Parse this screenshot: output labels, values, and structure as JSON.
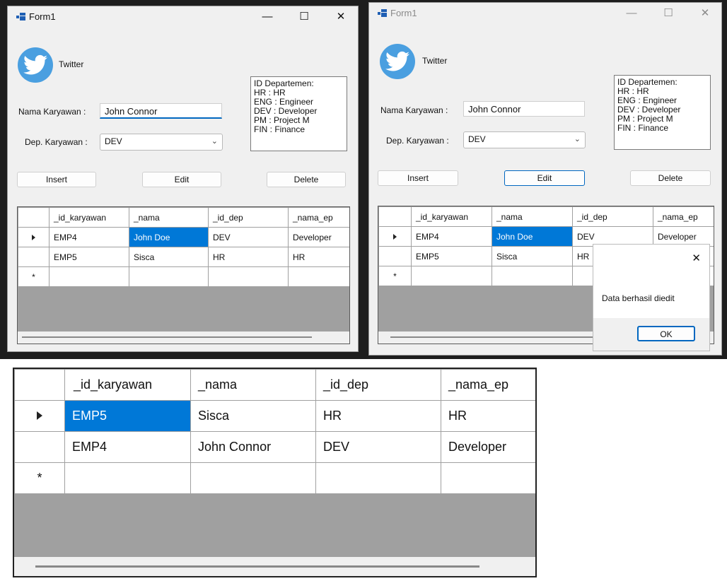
{
  "form": {
    "title": "Form1",
    "logo_label": "Twitter",
    "nama_label": "Nama Karyawan :",
    "nama_value": "John Connor",
    "dep_label": "Dep. Karyawan :",
    "dep_value": "DEV",
    "info_lines": [
      "ID Departemen:",
      "HR : HR",
      "ENG : Engineer",
      "DEV : Developer",
      "PM : Project M",
      "FIN : Finance"
    ],
    "buttons": {
      "insert": "Insert",
      "edit": "Edit",
      "delete": "Delete"
    },
    "window_controls": {
      "minimize": "—",
      "maximize": "☐",
      "close": "✕"
    }
  },
  "grid": {
    "columns": [
      "_id_karyawan",
      "_nama",
      "_id_dep",
      "_nama_ep"
    ],
    "rows_before": [
      [
        "EMP4",
        "John Doe",
        "DEV",
        "Developer"
      ],
      [
        "EMP5",
        "Sisca",
        "HR",
        "HR"
      ]
    ],
    "rows_after": [
      [
        "EMP5",
        "Sisca",
        "HR",
        "HR"
      ],
      [
        "EMP4",
        "John Connor",
        "DEV",
        "Developer"
      ]
    ],
    "new_row_marker": "*"
  },
  "messagebox": {
    "text": "Data berhasil diedit",
    "ok": "OK",
    "close": "✕"
  },
  "colors": {
    "selection": "#0078d7",
    "accent": "#0067c0",
    "twitter_blue": "#4a9fe0",
    "grid_background": "#a0a0a0"
  }
}
